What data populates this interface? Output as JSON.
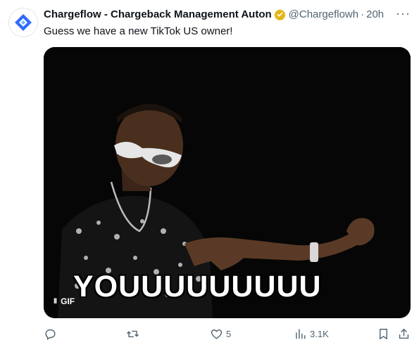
{
  "post": {
    "author_name": "Chargeflow - Chargeback Management Auton",
    "handle": "@Chargeflowh",
    "separator": "·",
    "time": "20h",
    "more_glyph": "···",
    "text": "Guess we have a new TikTok US owner!"
  },
  "media": {
    "caption": "YOUUUUUUUUU",
    "gif_label": "GIF",
    "pause_glyph": "II"
  },
  "actions": {
    "reply_count": "",
    "repost_count": "",
    "like_count": "5",
    "views_count": "3.1K"
  },
  "icons": {
    "avatar": "chargeflow-logo-icon",
    "verified": "verified-badge-icon",
    "reply": "reply-icon",
    "repost": "repost-icon",
    "like": "heart-icon",
    "views": "views-icon",
    "bookmark": "bookmark-icon",
    "share": "share-icon"
  },
  "colors": {
    "brand_blue": "#2f6bff",
    "verified_gold": "#e2b719",
    "muted_text": "#536471"
  }
}
